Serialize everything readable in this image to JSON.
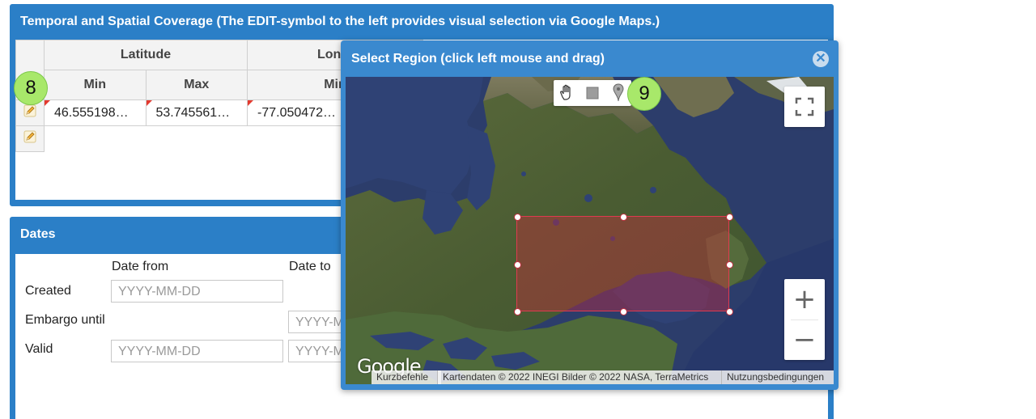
{
  "coverage": {
    "title": "Temporal and Spatial Coverage (The EDIT-symbol to the left provides visual selection via Google Maps.)",
    "header_groups": [
      "Latitude",
      "Lon"
    ],
    "sub_headers": [
      "Min",
      "Max",
      "Min"
    ],
    "rows": [
      {
        "values": [
          "46.555198…",
          "53.745561…",
          "-77.050472…"
        ]
      },
      {
        "values": [
          "",
          "",
          ""
        ]
      }
    ],
    "badge": "8"
  },
  "dates": {
    "title": "Dates",
    "col_from": "Date from",
    "col_to": "Date to",
    "rows": [
      {
        "label": "Created",
        "from_placeholder": "YYYY-MM-DD",
        "to_placeholder": ""
      },
      {
        "label": "Embargo until",
        "from_placeholder": "",
        "to_placeholder": "YYYY-M"
      },
      {
        "label": "Valid",
        "from_placeholder": "YYYY-MM-DD",
        "to_placeholder": "YYYY-M"
      }
    ]
  },
  "modal": {
    "title": "Select Region (click left mouse and drag)",
    "close_icon": "close-circle-icon",
    "badge": "9",
    "tools": [
      "hand-pan-icon",
      "rectangle-draw-icon",
      "marker-icon"
    ],
    "fullscreen_icon": "fullscreen-icon",
    "zoom_in": "+",
    "zoom_out": "−",
    "logo": "Google",
    "attribution": {
      "shortcuts": "Kurzbefehle",
      "data": "Kartendaten © 2022 INEGI Bilder © 2022 NASA, TerraMetrics",
      "terms": "Nutzungsbedingungen"
    }
  },
  "colors": {
    "panel_blue": "#2b7fc7",
    "modal_blue": "#3a89cf",
    "badge_green": "#a8e86a",
    "selection_red": "#d2283c"
  }
}
